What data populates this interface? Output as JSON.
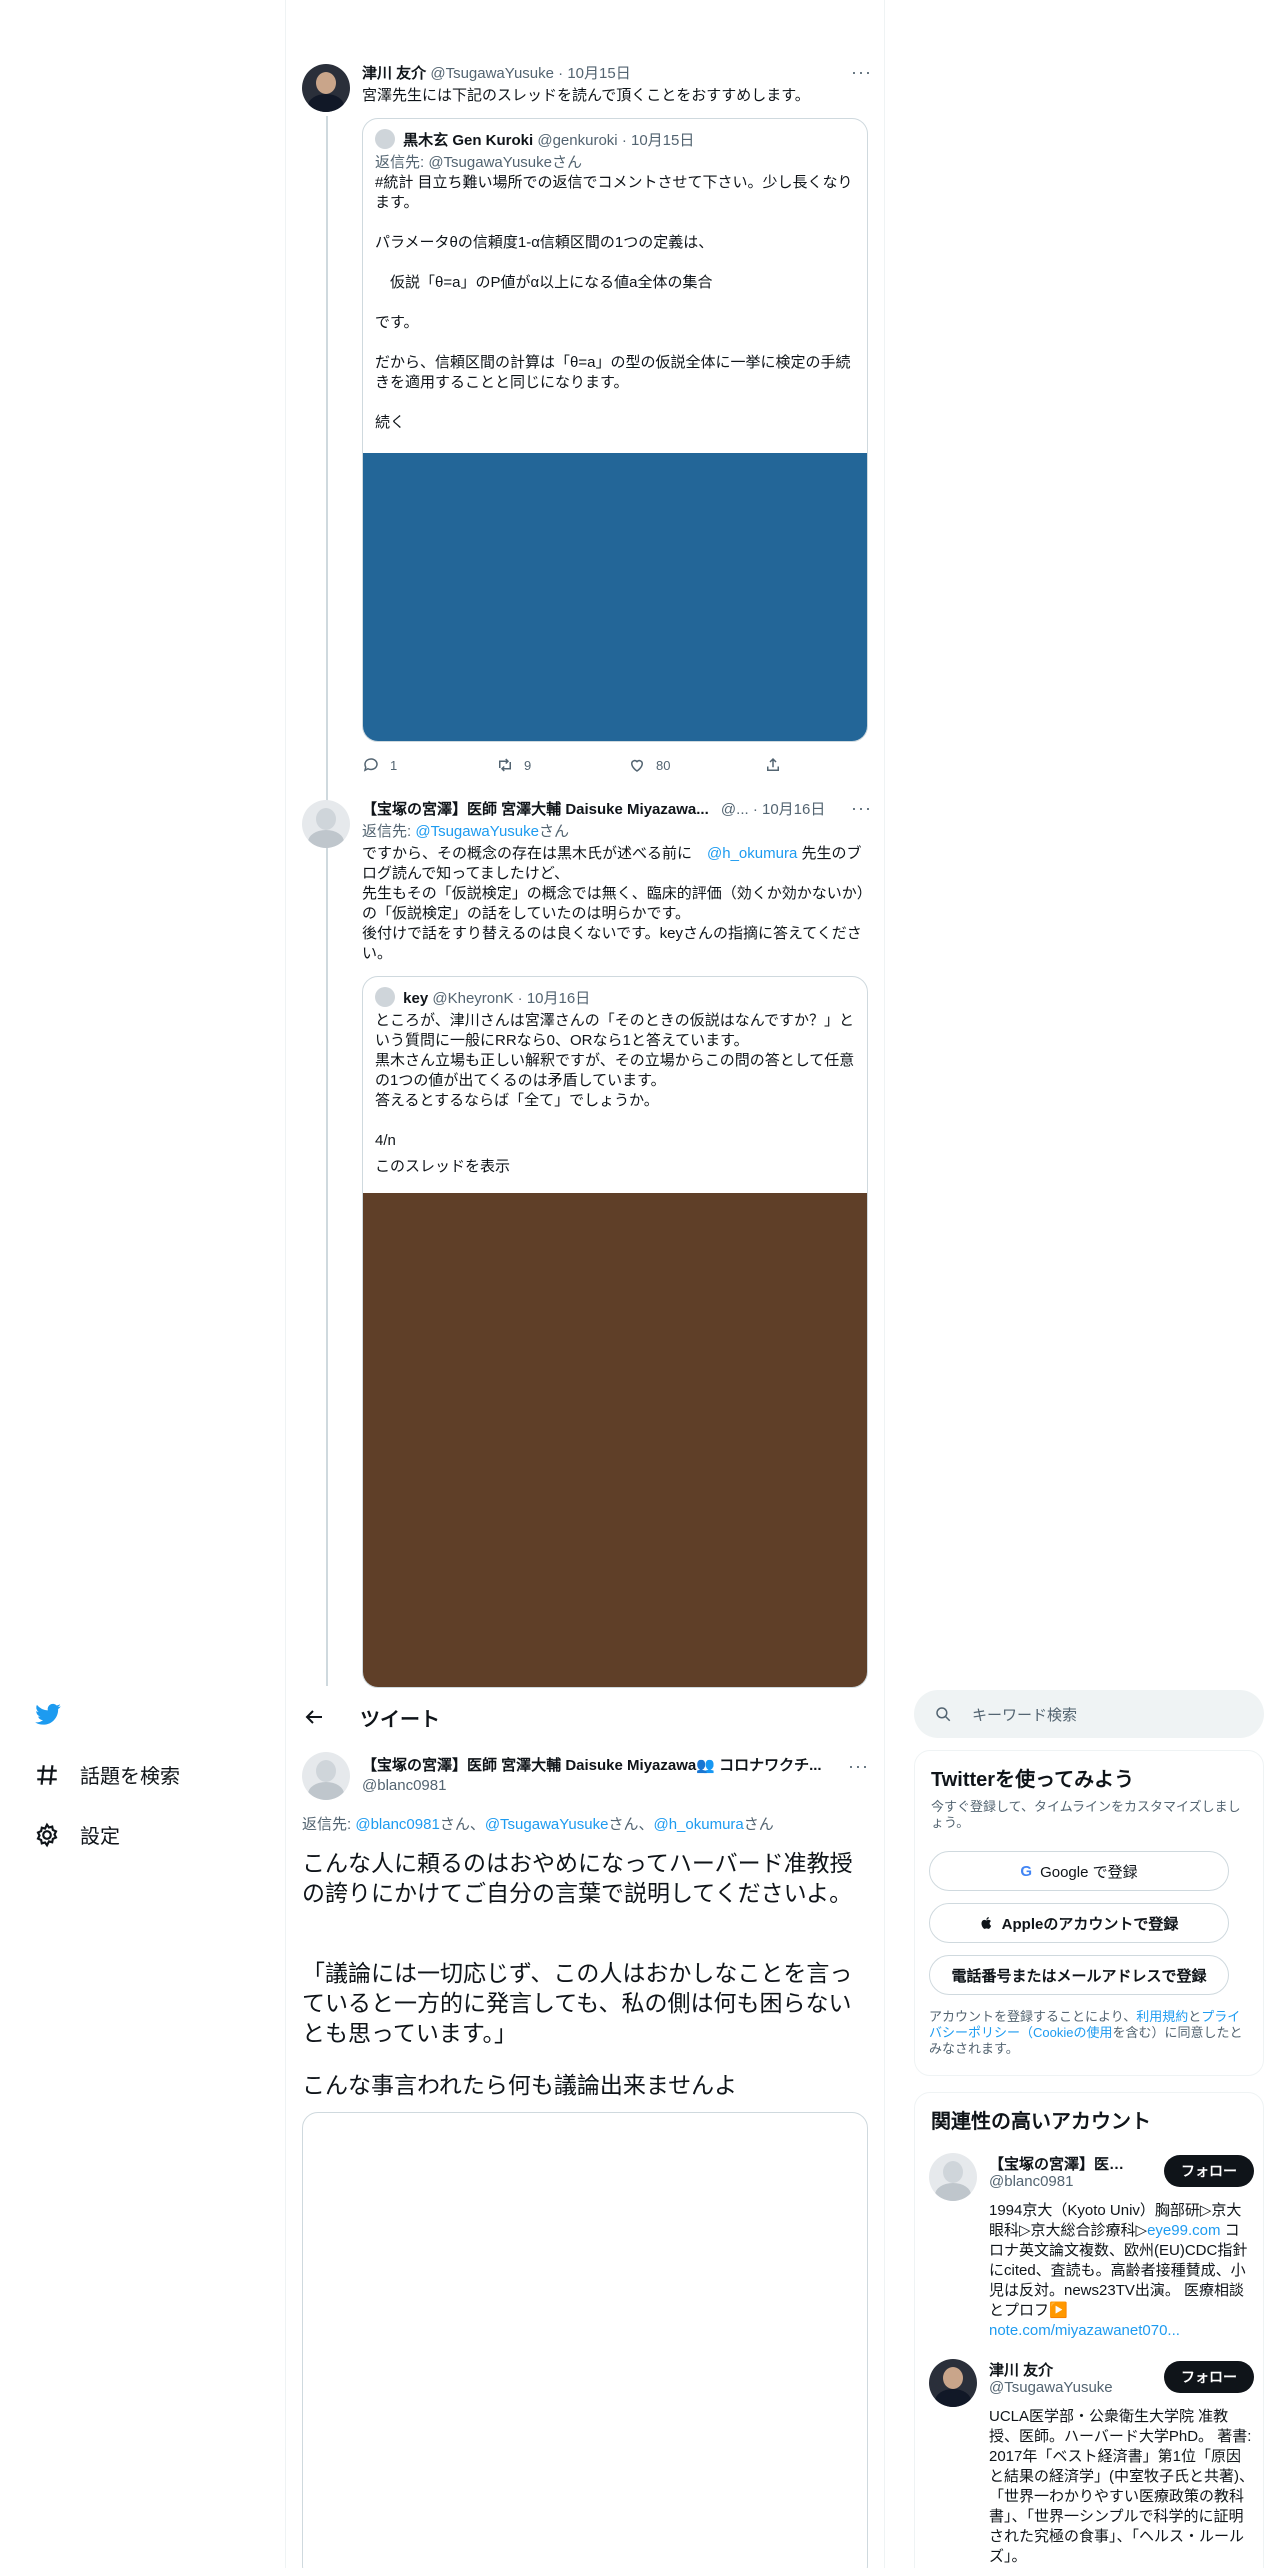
{
  "thread": {
    "tweet1": {
      "name": "津川 友介",
      "handle": "@TsugawaYusuke",
      "date": "10月15日",
      "text": "宮澤先生には下記のスレッドを読んで頂くことをおすすめします。",
      "quote": {
        "name": "黒木玄 Gen Kuroki",
        "handle": "@genkuroki",
        "date": "10月15日",
        "reply_label": "返信先: @TsugawaYusukeさん",
        "text": "#統計 目立ち難い場所での返信でコメントさせて下さい。少し長くなります。\n\nパラメータθの信頼度1-α信頼区間の1つの定義は、\n\n　仮説「θ=a」のP値がα以上になる値a全体の集合\n\nです。\n\nだから、信頼区間の計算は「θ=a」の型の仮説全体に一挙に検定の手続きを適用することと同じになります。\n\n続く",
        "image_color": "#236698"
      },
      "actions": {
        "reply": "1",
        "retweet": "9",
        "like": "80"
      }
    },
    "tweet2": {
      "name": "【宝塚の宮澤】医師 宮澤大輔 Daisuke Miyazawa...",
      "handle": "@...",
      "date": "10月16日",
      "reply_prefix": "返信先: ",
      "reply_user": "@TsugawaYusuke",
      "reply_suffix": "さん",
      "text_before_mention": "ですから、その概念の存在は黒木氏が述べる前に　",
      "mention": "@h_okumura",
      "text_after_mention": " 先生のブログ読んで知ってましたけど、\n先生もその「仮説検定」の概念では無く、臨床的評価（効くか効かないか）の「仮説検定」の話をしていたのは明らかです。\n後付けで話をすり替えるのは良くないです。keyさんの指摘に答えてください。",
      "quote": {
        "name": "key",
        "handle": "@KheyronK",
        "date": "10月16日",
        "text": "ところが、津川さんは宮澤さんの「そのときの仮説はなんですか？」という質問に一般にRRなら0、ORなら1と答えています。\n黒木さん立場も正しい解釈ですが、その立場からこの問の答として任意の1つの値が出てくるのは矛盾しています。\n答えるとするならば「全て」でしょうか。\n\n4/n",
        "show_thread": "このスレッドを表示",
        "image_color": "#5f3f28"
      }
    }
  },
  "nav": {
    "explore": "話題を検索",
    "settings": "設定"
  },
  "main": {
    "header_title": "ツイート",
    "tweet": {
      "name": "【宝塚の宮澤】医師 宮澤大輔 Daisuke Miyazawa👥 コロナワクチ...",
      "handle": "@blanc0981",
      "reply_prefix": "返信先: ",
      "reply_user1": "@blanc0981",
      "reply_sep1": "さん、",
      "reply_user2": "@TsugawaYusuke",
      "reply_sep2": "さん、",
      "reply_user3": "@h_okumura",
      "reply_suffix": "さん",
      "para1": "こんな人に頼るのはおやめになってハーバード准教授の誇りにかけてご自分の言葉で説明してくださいよ。",
      "para2": "「議論には一切応じず、この人はおかしなことを言っていると一方的に発言しても、私の側は何も困らないとも思っています。」",
      "para3": "こんな事言われたら何も議論出来ませんよ"
    }
  },
  "sidebar": {
    "search_placeholder": "キーワード検索",
    "signup": {
      "title": "Twitterを使ってみよう",
      "subtitle": "今すぐ登録して、タイムラインをカスタマイズしましょう。",
      "google": "Google で登録",
      "apple": "Appleのアカウントで登録",
      "phone": "電話番号またはメールアドレスで登録",
      "legal_1": "アカウントを登録することにより、",
      "legal_terms": "利用規約",
      "legal_2": "と",
      "legal_privacy": "プライバシーポリシー（Cookieの使用",
      "legal_3": "を含む）に同意したとみなされます。"
    },
    "relevant": {
      "title": "関連性の高いアカウント",
      "accounts": [
        {
          "name": "【宝塚の宮澤】医師 ...",
          "handle": "@blanc0981",
          "follow": "フォロー",
          "bio_1": "1994京大（Kyoto Univ）胸部研▷京大眼科▷京大総合診療科▷",
          "bio_link1": "eye99.com",
          "bio_2": " コロナ英文論文複数、欧州(EU)CDC指針にcited、査読も。高齢者接種賛成、小児は反対。news23TV出演。 医療相談とプロフ▶️ ",
          "bio_link2": "note.com/miyazawanet070..."
        },
        {
          "name": "津川 友介",
          "handle": "@TsugawaYusuke",
          "follow": "フォロー",
          "bio": "UCLA医学部・公衆衛生大学院 准教授、医師。ハーバード大学PhD。 著書: 2017年「ベスト経済書」第1位「原因と結果の経済学」(中室牧子氏と共著)、「世界一わかりやすい医療政策の教科書」、「世界一シンプルで科学的に証明された究極の食事」、「ヘルス・ルールズ」。"
        }
      ]
    }
  },
  "colors": {
    "accent": "#1d9bf0",
    "text": "#0f1419",
    "muted": "#536471"
  }
}
